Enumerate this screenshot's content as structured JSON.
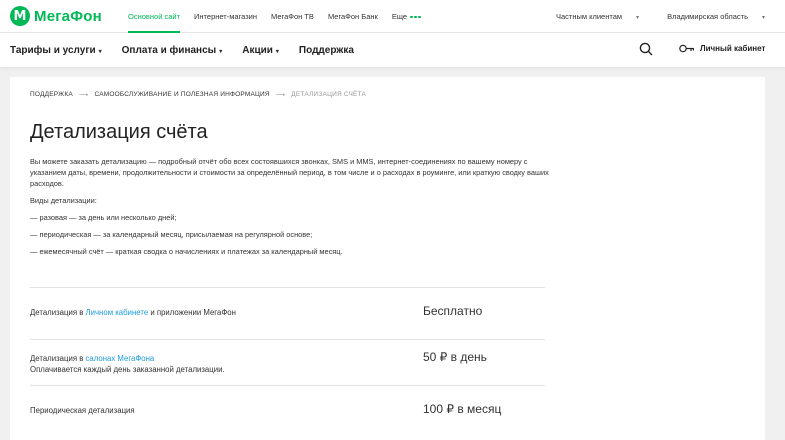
{
  "brand": {
    "name": "МегаФон",
    "mark": "M",
    "color": "#00b956"
  },
  "topnav": {
    "items": [
      "Основной сайт",
      "Интернет-магазин",
      "МегаФон ТВ",
      "МегаФон Банк",
      "Еще"
    ],
    "active": "Основной сайт"
  },
  "topright": {
    "clients": "Частным клиентам",
    "region": "Владимирская область"
  },
  "mainnav": {
    "items": [
      "Тарифы и услуги",
      "Оплата и финансы",
      "Акции",
      "Поддержка"
    ]
  },
  "cabinet": {
    "label": "Личный кабинет"
  },
  "breadcrumbs": [
    "ПОДДЕРЖКА",
    "САМООБСЛУЖИВАНИЕ И ПОЛЕЗНАЯ ИНФОРМАЦИЯ",
    "ДЕТАЛИЗАЦИЯ СЧЁТА"
  ],
  "page": {
    "title": "Детализация счёта",
    "intro": "Вы можете заказать детализацию — подробный отчёт обо всех состоявшихся звонках, SMS и MMS, интернет-соединениях по вашему номеру с указанием даты, времени, продолжительности и стоимости за определённый период, в том числе и о расходах в роуминге, или краткую сводку ваших расходов.",
    "kinds_title": "Виды детализации:",
    "kinds": [
      "разовая — за день или несколько дней;",
      "периодическая — за календарный месяц, присылаемая на регулярной основе;",
      "ежемесячный счёт — краткая сводка о начислениях и платежах за календарный месяц."
    ]
  },
  "prices": [
    {
      "pre": "Детализация в ",
      "link": "Личном кабинете",
      "post": " и приложении МегаФон",
      "note": "",
      "price": "Бесплатно"
    },
    {
      "pre": "Детализация в ",
      "link": "салонах МегаФона",
      "post": "",
      "note": "Оплачивается каждый день заказанной детализации.",
      "price": "50 ₽ в день"
    },
    {
      "pre": "Периодическая детализация",
      "link": "",
      "post": "",
      "note": "",
      "price": "100 ₽ в месяц"
    }
  ],
  "colors": {
    "accent": "#00b956",
    "link": "#1e9dd8"
  },
  "icons": {
    "search": "search-icon",
    "key": "key-icon",
    "logo": "megafon-logo-icon"
  }
}
